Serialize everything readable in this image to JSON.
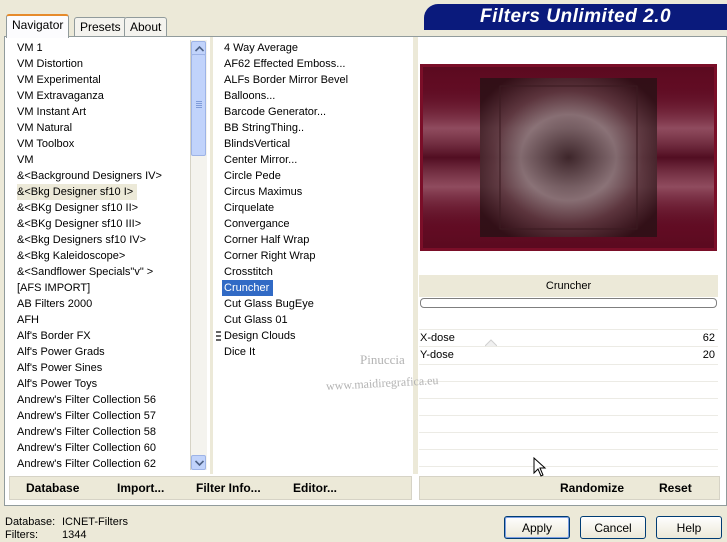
{
  "banner_title": "Filters Unlimited 2.0",
  "tabs": [
    {
      "label": "Navigator",
      "active": true
    },
    {
      "label": "Presets",
      "active": false
    },
    {
      "label": "About",
      "active": false
    }
  ],
  "categories": [
    "VM 1",
    "VM Distortion",
    "VM Experimental",
    "VM Extravaganza",
    "VM Instant Art",
    "VM Natural",
    "VM Toolbox",
    "VM",
    "&<Background Designers IV>",
    "&<Bkg Designer sf10 I>",
    "&<BKg Designer sf10 II>",
    "&<BKg Designer sf10 III>",
    "&<Bkg Designers sf10 IV>",
    "&<Bkg Kaleidoscope>",
    "&<Sandflower Specials\"v\" >",
    "[AFS IMPORT]",
    "AB Filters 2000",
    "AFH",
    "Alf's Border FX",
    "Alf's Power Grads",
    "Alf's Power Sines",
    "Alf's Power Toys",
    "Andrew's Filter Collection 56",
    "Andrew's Filter Collection 57",
    "Andrew's Filter Collection 58",
    "Andrew's Filter Collection 60",
    "Andrew's Filter Collection 62"
  ],
  "selected_category": "&<Bkg Designer sf10 I>",
  "filters": [
    "4 Way Average",
    "AF62 Effected Emboss...",
    "ALFs Border Mirror Bevel",
    "Balloons...",
    "Barcode Generator...",
    "BB StringThing..",
    "BlindsVertical",
    "Center Mirror...",
    "Circle Pede",
    "Circus Maximus",
    "Cirquelate",
    "Convergance",
    "Corner Half Wrap",
    "Corner Right Wrap",
    "Crosstitch",
    "Cruncher",
    "Cut Glass  BugEye",
    "Cut Glass 01",
    "Design Clouds",
    "Dice It"
  ],
  "selected_filter": "Cruncher",
  "filter_name": "Cruncher",
  "params": [
    {
      "label": "X-dose",
      "value": "62"
    },
    {
      "label": "Y-dose",
      "value": "20"
    }
  ],
  "toolbar": {
    "database": "Database",
    "import": "Import...",
    "filter_info": "Filter Info...",
    "editor": "Editor...",
    "randomize": "Randomize",
    "reset": "Reset"
  },
  "status": {
    "database_label": "Database:",
    "database_value": "ICNET-Filters",
    "filters_label": "Filters:",
    "filters_value": "1344"
  },
  "buttons": {
    "apply": "Apply",
    "cancel": "Cancel",
    "help": "Help"
  },
  "watermark": {
    "line1": "Pinuccia",
    "line2": "www.maidiregrafica.eu"
  },
  "colors": {
    "banner": "#0a1a7c",
    "selection": "#316ac5",
    "preview_border": "#7a0e28"
  }
}
